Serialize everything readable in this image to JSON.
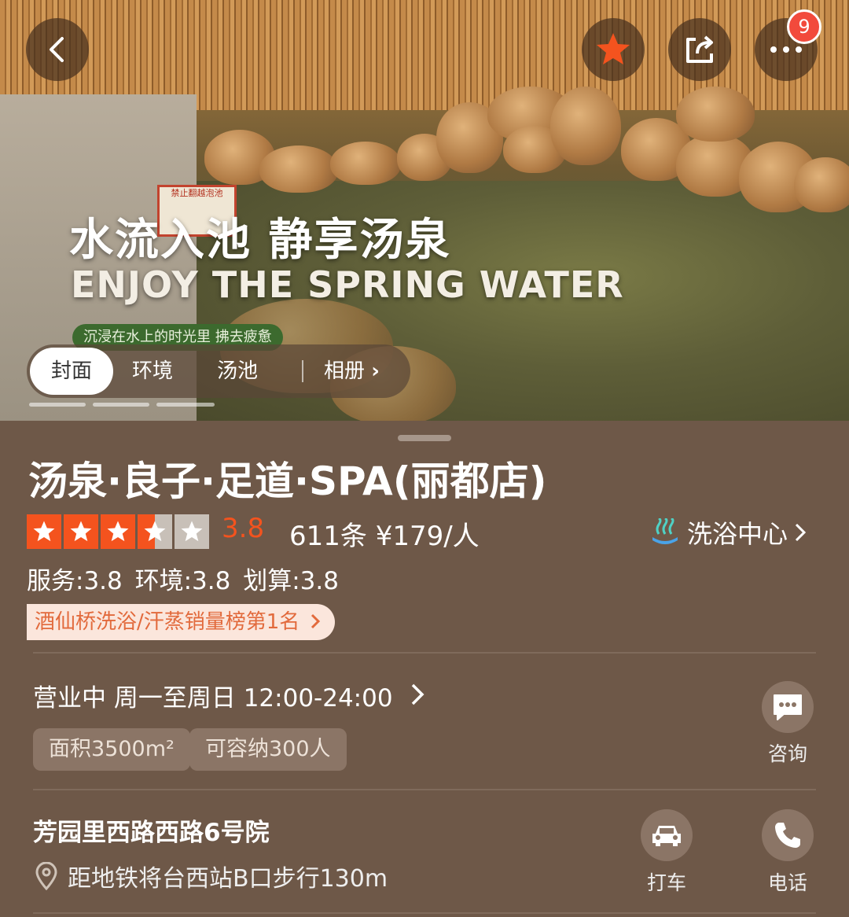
{
  "hero": {
    "headline_cn": "水流入池 静享汤泉",
    "headline_en": "ENJOY THE SPRING WATER",
    "subtitle": "沉浸在水上的时光里 拂去疲惫",
    "sign_text": "禁止翻越泡池",
    "notification_count": "9",
    "tabs": [
      {
        "label": "封面",
        "active": true
      },
      {
        "label": "环境",
        "active": false
      },
      {
        "label": "汤池",
        "active": false
      },
      {
        "label": "相册",
        "active": false
      }
    ],
    "album_chevron": "›"
  },
  "shop": {
    "title": "汤泉·良子·足道·SPA(丽都店)",
    "rating": "3.8",
    "star_level": 3.8,
    "reviews_price": "611条 ¥179/人",
    "category": "洗浴中心",
    "subscores": "服务:3.8 环境:3.8 划算:3.8",
    "rank": "酒仙桥洗浴/汗蒸销量榜第1名"
  },
  "hours": {
    "text": "营业中  周一至周日 12:00-24:00",
    "tags": [
      "面积3500m²",
      "可容纳300人"
    ]
  },
  "actions": {
    "consult_label": "咨询",
    "taxi_label": "打车",
    "phone_label": "电话"
  },
  "location": {
    "address": "芳园里西路西路6号院",
    "metro": "距地铁将台西站B口步行130m"
  },
  "colors": {
    "accent": "#f4531e",
    "panel_bg": "#6e5848",
    "chip_bg": "#8b7566"
  }
}
